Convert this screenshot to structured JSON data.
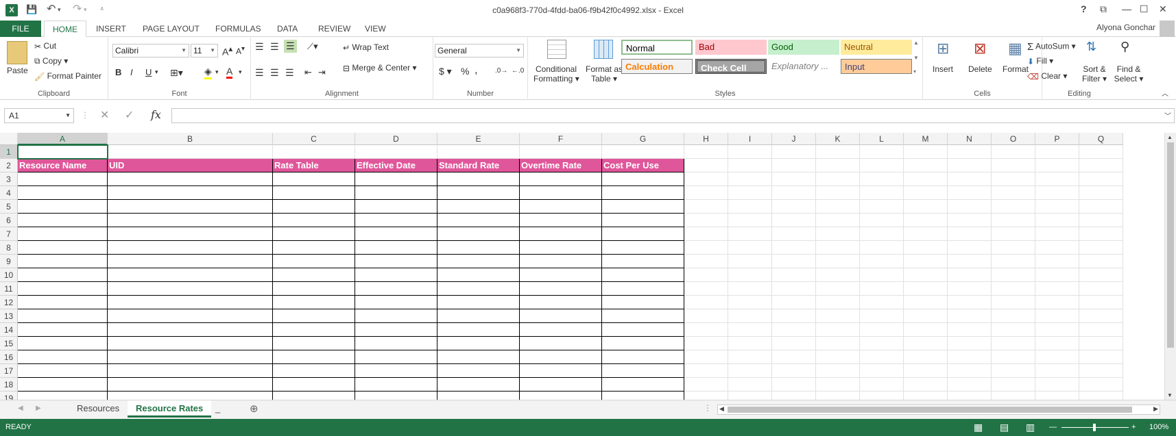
{
  "window": {
    "title": "c0a968f3-770d-4fdd-ba06-f9b42f0c4992.xlsx - Excel",
    "help": "?",
    "restore": "⧉",
    "minimize": "—",
    "maximize": "☐",
    "close": "✕"
  },
  "qat": {
    "logo": "X",
    "save": "💾",
    "undo": "↶",
    "undo_dd": "▾",
    "redo": "↷",
    "redo_dd": "▾",
    "customize": "⩡"
  },
  "tabs": [
    "FILE",
    "HOME",
    "INSERT",
    "PAGE LAYOUT",
    "FORMULAS",
    "DATA",
    "REVIEW",
    "VIEW"
  ],
  "user": "Alyona Gonchar",
  "ribbon": {
    "clipboard": {
      "label": "Clipboard",
      "paste": "Paste",
      "cut": "Cut",
      "copy": "Copy",
      "format_painter": "Format Painter"
    },
    "font": {
      "label": "Font",
      "name": "Calibri",
      "size": "11",
      "bold": "B",
      "italic": "I",
      "underline": "U"
    },
    "alignment": {
      "label": "Alignment",
      "wrap": "Wrap Text",
      "merge": "Merge & Center"
    },
    "number": {
      "label": "Number",
      "format": "General",
      "currency": "$",
      "percent": "%",
      "comma": ","
    },
    "styles": {
      "label": "Styles",
      "conditional": "Conditional",
      "conditional2": "Formatting",
      "format_as": "Format as",
      "table": "Table",
      "normal": "Normal",
      "bad": "Bad",
      "good": "Good",
      "neutral": "Neutral",
      "calculation": "Calculation",
      "check_cell": "Check Cell",
      "explanatory": "Explanatory ...",
      "input": "Input"
    },
    "cells": {
      "label": "Cells",
      "insert": "Insert",
      "delete": "Delete",
      "format": "Format"
    },
    "editing": {
      "label": "Editing",
      "autosum": "AutoSum",
      "fill": "Fill",
      "clear": "Clear",
      "sort": "Sort &",
      "filter": "Filter",
      "find": "Find &",
      "select": "Select"
    }
  },
  "formula_bar": {
    "name_box": "A1",
    "fx": "fx",
    "value": ""
  },
  "columns": [
    "A",
    "B",
    "C",
    "D",
    "E",
    "F",
    "G",
    "H",
    "I",
    "J",
    "K",
    "L",
    "M",
    "N",
    "O",
    "P",
    "Q"
  ],
  "rows": [
    "1",
    "2",
    "3",
    "4",
    "5",
    "6",
    "7",
    "8",
    "9",
    "10",
    "11",
    "12",
    "13",
    "14",
    "15",
    "16",
    "17",
    "18",
    "19"
  ],
  "headers": [
    "Resource Name",
    "UID",
    "Rate Table",
    "Effective Date",
    "Standard Rate",
    "Overtime Rate",
    "Cost Per Use"
  ],
  "sheets": [
    "Resources",
    "Resource Rates",
    "_"
  ],
  "status": {
    "mode": "READY",
    "zoom": "100%"
  }
}
